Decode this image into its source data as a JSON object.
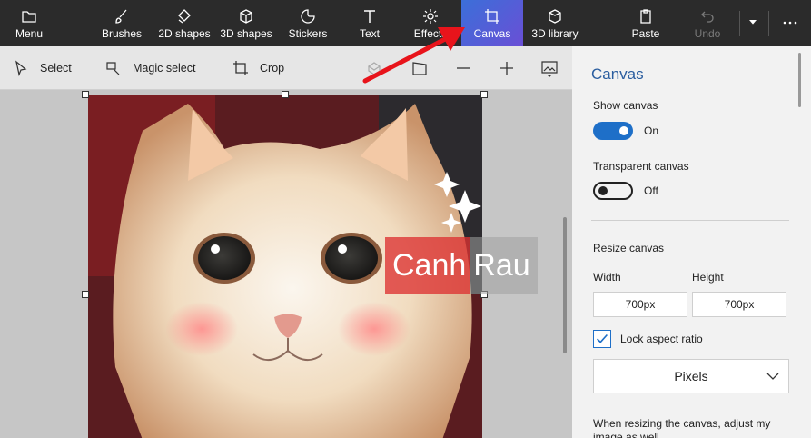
{
  "toolbar": {
    "menu": "Menu",
    "brushes": "Brushes",
    "shapes2d": "2D shapes",
    "shapes3d": "3D shapes",
    "stickers": "Stickers",
    "text": "Text",
    "effects": "Effects",
    "canvas": "Canvas",
    "library3d": "3D library",
    "paste": "Paste",
    "undo": "Undo"
  },
  "subtoolbar": {
    "select": "Select",
    "magic_select": "Magic select",
    "crop": "Crop"
  },
  "watermark": {
    "left": "Canh",
    "right": "Rau"
  },
  "panel": {
    "title": "Canvas",
    "show_canvas_label": "Show canvas",
    "show_canvas_state": "On",
    "transparent_label": "Transparent canvas",
    "transparent_state": "Off",
    "resize_label": "Resize canvas",
    "width_label": "Width",
    "height_label": "Height",
    "width_value": "700px",
    "height_value": "700px",
    "lock_label": "Lock aspect ratio",
    "units": "Pixels",
    "help_text": "When resizing the canvas, adjust my image as well"
  },
  "colors": {
    "accent": "#1e6fc8",
    "active_tab": "#4a5fd8",
    "arrow": "#e8141b"
  }
}
